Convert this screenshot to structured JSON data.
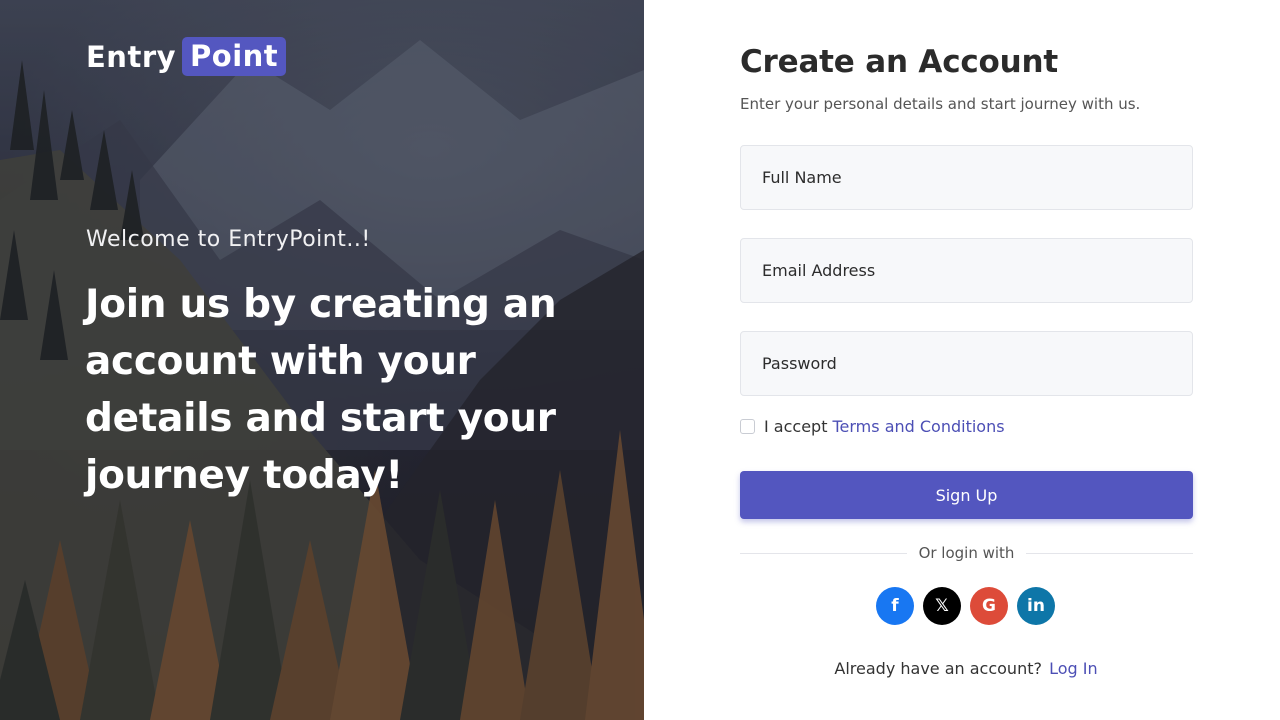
{
  "brand": {
    "part1": "Entry",
    "part2": "Point",
    "accent": "#5457c0"
  },
  "hero": {
    "welcome": "Welcome to EntryPoint..!",
    "headline": "Join us by creating an account with your details and start your journey today!"
  },
  "form": {
    "title": "Create an Account",
    "subtitle": "Enter your personal details and start journey with us.",
    "full_name_placeholder": "Full Name",
    "email_placeholder": "Email Address",
    "password_placeholder": "Password",
    "terms_prefix": "I accept",
    "terms_link": "Terms and Conditions",
    "terms_checked": false,
    "signup_label": "Sign Up",
    "divider_text": "Or login with",
    "login_prompt": "Already have an account?",
    "login_link": "Log In"
  },
  "socials": [
    {
      "name": "facebook-icon",
      "glyph": "f",
      "color": "#1877f2"
    },
    {
      "name": "x-icon",
      "glyph": "𝕏",
      "color": "#000000"
    },
    {
      "name": "google-icon",
      "glyph": "G",
      "color": "#dd4b39"
    },
    {
      "name": "linkedin-icon",
      "glyph": "in",
      "color": "#0e76a8"
    }
  ]
}
